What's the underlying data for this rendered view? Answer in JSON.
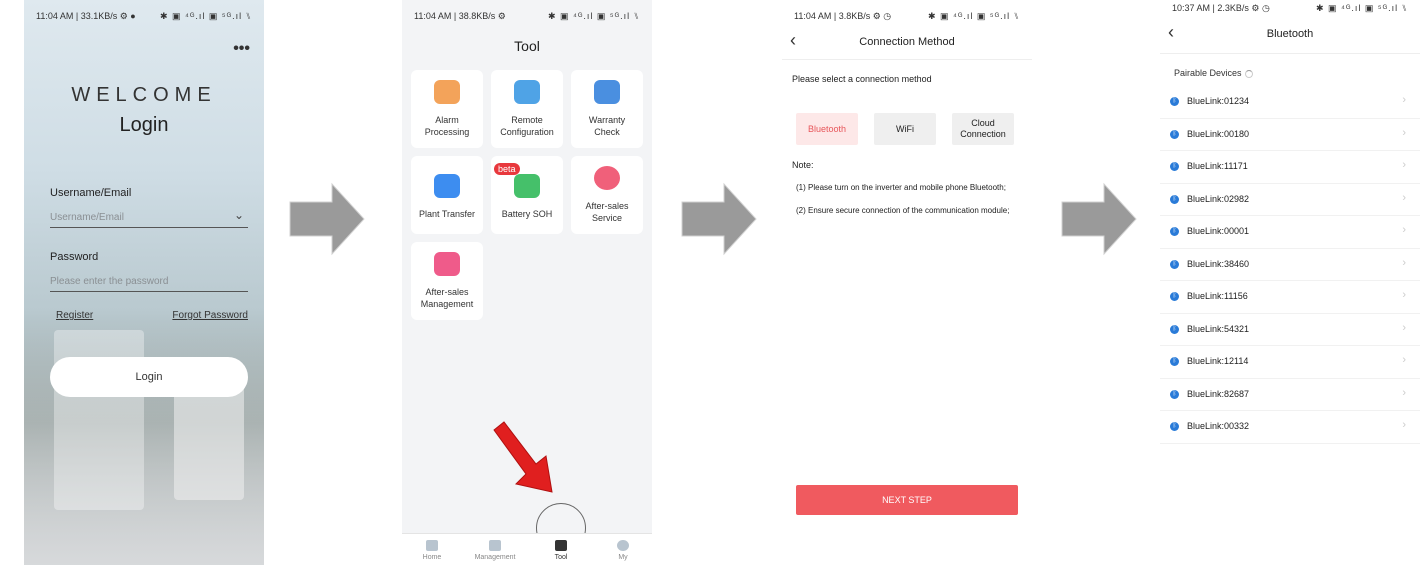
{
  "screen1": {
    "status_left": "11:04 AM | 33.1KB/s ⚙ ●",
    "status_right": "✱ ▣ ⁴ᴳ.ıl ▣ ⁵ᴳ.ıl ⑊",
    "more_icon": "•••",
    "welcome": "WELCOME",
    "title": "Login",
    "username_label": "Username/Email",
    "username_placeholder": "Username/Email",
    "password_label": "Password",
    "password_placeholder": "Please enter the password",
    "register_label": "Register",
    "forgot_label": "Forgot Password",
    "login_button": "Login"
  },
  "screen2": {
    "status_left": "11:04 AM | 38.8KB/s ⚙",
    "status_right": "✱ ▣ ⁴ᴳ.ıl ▣ ⁵ᴳ.ıl ⑊",
    "title": "Tool",
    "tiles": [
      {
        "label": "Alarm\nProcessing",
        "color": "#f3a35a"
      },
      {
        "label": "Remote\nConfiguration",
        "color": "#4fa3e6"
      },
      {
        "label": "Warranty\nCheck",
        "color": "#4a8fe0"
      },
      {
        "label": "Plant Transfer",
        "color": "#3d8df0"
      },
      {
        "label": "Battery SOH",
        "color": "#45c06a",
        "badge": "beta"
      },
      {
        "label": "After-sales\nService",
        "color": "#f0607a"
      },
      {
        "label": "After-sales\nManagement",
        "color": "#ef5b8a"
      }
    ],
    "tabs": [
      "Home",
      "Management",
      "Tool",
      "My"
    ]
  },
  "screen3": {
    "status_left": "11:04 AM | 3.8KB/s ⚙ ◷",
    "status_right": "✱ ▣ ⁴ᴳ.ıl ▣ ⁵ᴳ.ıl ⑊",
    "title": "Connection Method",
    "prompt": "Please select a connection method",
    "options": [
      "Bluetooth",
      "WiFi",
      "Cloud\nConnection"
    ],
    "selected": "Bluetooth",
    "note_title": "Note:",
    "note_1": "(1) Please turn on the inverter and mobile phone Bluetooth;",
    "note_2": "(2) Ensure secure connection of the communication module;",
    "next_button": "NEXT STEP"
  },
  "screen4": {
    "status_left": "10:37 AM | 2.3KB/s ⚙ ◷",
    "status_right": "✱ ▣ ⁴ᴳ.ıl ▣ ⁵ᴳ.ıl ⑊",
    "title": "Bluetooth",
    "pairable": "Pairable Devices",
    "devices": [
      "BlueLink:01234",
      "BlueLink:00180",
      "BlueLink:11171",
      "BlueLink:02982",
      "BlueLink:00001",
      "BlueLink:38460",
      "BlueLink:11156",
      "BlueLink:54321",
      "BlueLink:12114",
      "BlueLink:82687",
      "BlueLink:00332"
    ]
  },
  "colors": {
    "accent": "#f05a5f",
    "flow_arrow": "#9a9a9a",
    "highlight_arrow": "#e01f1f"
  }
}
